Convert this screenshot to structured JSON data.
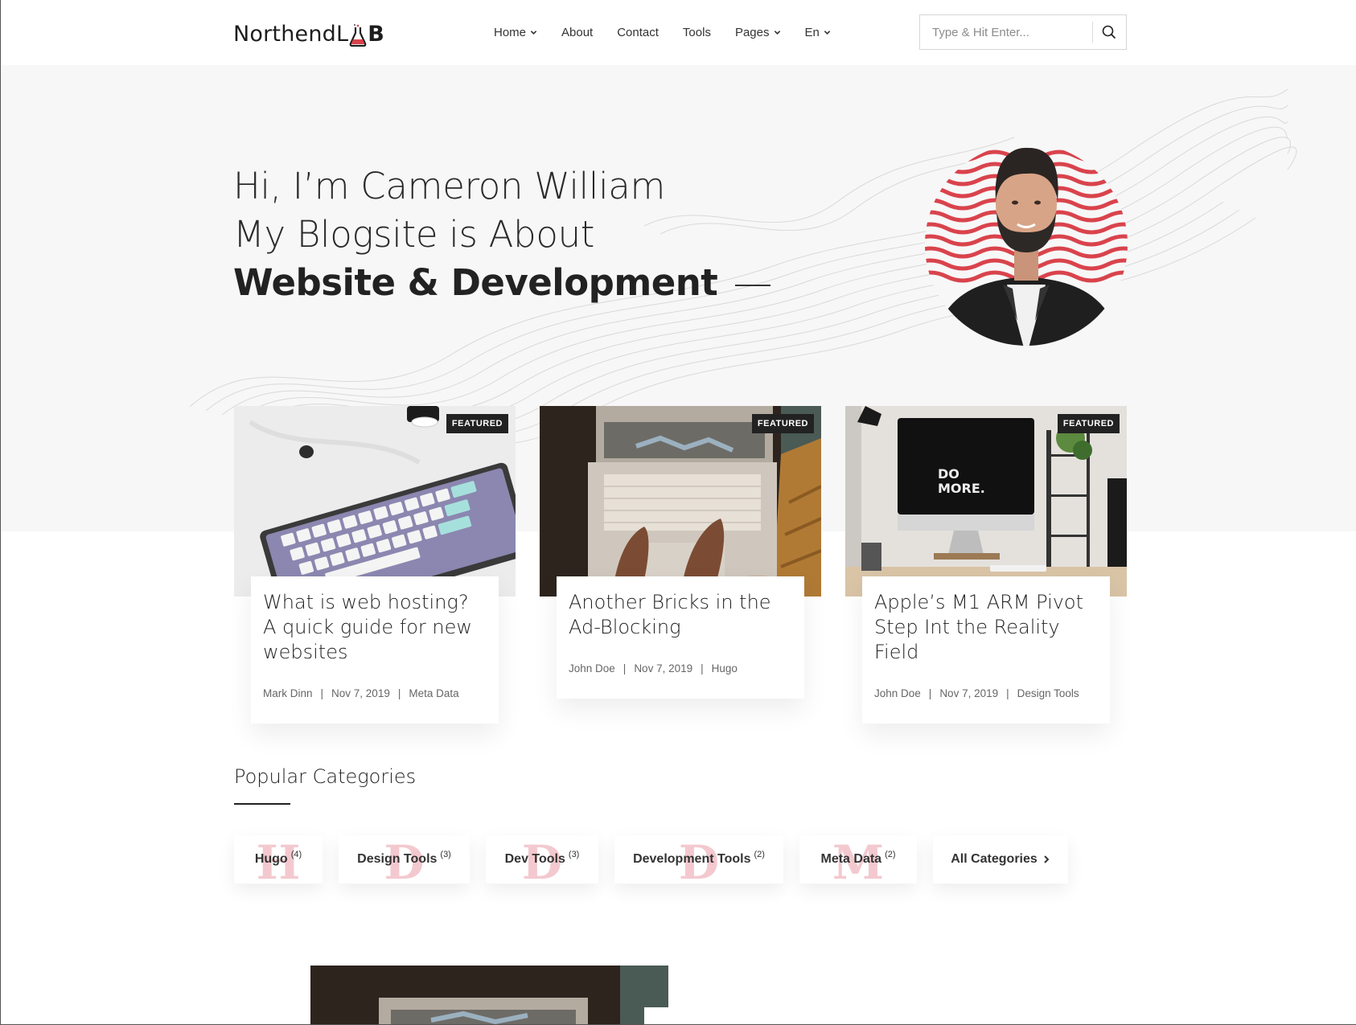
{
  "header": {
    "logo_text": "NorthendL",
    "logo_suffix": "B",
    "nav": [
      {
        "label": "Home",
        "dropdown": true
      },
      {
        "label": "About",
        "dropdown": false
      },
      {
        "label": "Contact",
        "dropdown": false
      },
      {
        "label": "Tools",
        "dropdown": false
      },
      {
        "label": "Pages",
        "dropdown": true
      },
      {
        "label": "En",
        "dropdown": true
      }
    ],
    "search_placeholder": "Type & Hit Enter..."
  },
  "hero": {
    "line1": "Hi, I’m Cameron William",
    "line2": "My Blogsite is About",
    "line3": "Website & Development",
    "accent_color": "#d9434c"
  },
  "featured": [
    {
      "badge": "FEATURED",
      "title": "What is web hosting? A quick guide for new websites",
      "author": "Mark Dinn",
      "date": "Nov 7, 2019",
      "category": "Meta Data"
    },
    {
      "badge": "FEATURED",
      "title": "Another Bricks in the Ad-Blocking",
      "author": "John Doe",
      "date": "Nov 7, 2019",
      "category": "Hugo"
    },
    {
      "badge": "FEATURED",
      "title": "Apple’s M1 ARM Pivot Step Int the Reality Field",
      "author": "John Doe",
      "date": "Nov 7, 2019",
      "category": "Design Tools"
    }
  ],
  "popular": {
    "title": "Popular Categories",
    "categories": [
      {
        "label": "Hugo",
        "count": "(4)",
        "initial": "H"
      },
      {
        "label": "Design Tools",
        "count": "(3)",
        "initial": "D"
      },
      {
        "label": "Dev Tools",
        "count": "(3)",
        "initial": "D"
      },
      {
        "label": "Development Tools",
        "count": "(2)",
        "initial": "D"
      },
      {
        "label": "Meta Data",
        "count": "(2)",
        "initial": "M"
      }
    ],
    "all_label": "All Categories"
  },
  "icons": {
    "search": "search-icon",
    "chevron": "chevron-down-icon",
    "arrow": "chevron-right-icon"
  }
}
